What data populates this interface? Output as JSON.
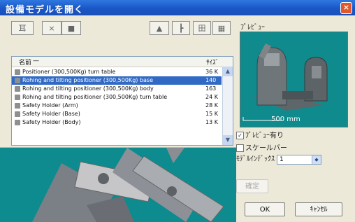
{
  "window": {
    "title": "設備モデルを開く",
    "close_label": "×"
  },
  "toolbar": {
    "left_buttons": [
      {
        "label": "耳"
      },
      {
        "label": "×"
      },
      {
        "label": "■"
      }
    ],
    "right_buttons": [
      {
        "label": "▲"
      },
      {
        "label": "┣"
      },
      {
        "label": "田"
      },
      {
        "label": "▦"
      }
    ]
  },
  "list": {
    "headers": {
      "name": "名前",
      "size": "ｻｲｽﾞ"
    },
    "rows": [
      {
        "name": "Positioner (300,500Kg) turn table",
        "size": "36 K",
        "selected": false
      },
      {
        "name": "Rohing and tilting positioner (300,500Kg) base",
        "size": "140",
        "selected": true
      },
      {
        "name": "Rohing and tilting positioner (300,500Kg) body",
        "size": "163",
        "selected": false
      },
      {
        "name": "Rohing and tilting positioner (300,500Kg) turn table",
        "size": "24 K",
        "selected": false
      },
      {
        "name": "Safety Holder (Arm)",
        "size": "28 K",
        "selected": false
      },
      {
        "name": "Safety Holder (Base)",
        "size": "15 K",
        "selected": false
      },
      {
        "name": "Safety Holder (Body)",
        "size": "13 K",
        "selected": false
      }
    ]
  },
  "preview": {
    "label": "ﾌﾟﾚﾋﾞｭｰ",
    "scale_text": "500 mm"
  },
  "options": {
    "preview_label": "ﾌﾟﾚﾋﾞｭｰ有り",
    "scale_label": "スケールバー",
    "model_index_label": "ﾓﾃﾞﾙｲﾝﾃﾞｯｸｽ",
    "model_index_value": "1"
  },
  "buttons": {
    "confirm_label": "確定",
    "ok_label": "OK",
    "cancel_label": "ｷｬﾝｾﾙ"
  },
  "colors": {
    "accent": "#316ac5",
    "teal": "#0f8b8d"
  }
}
